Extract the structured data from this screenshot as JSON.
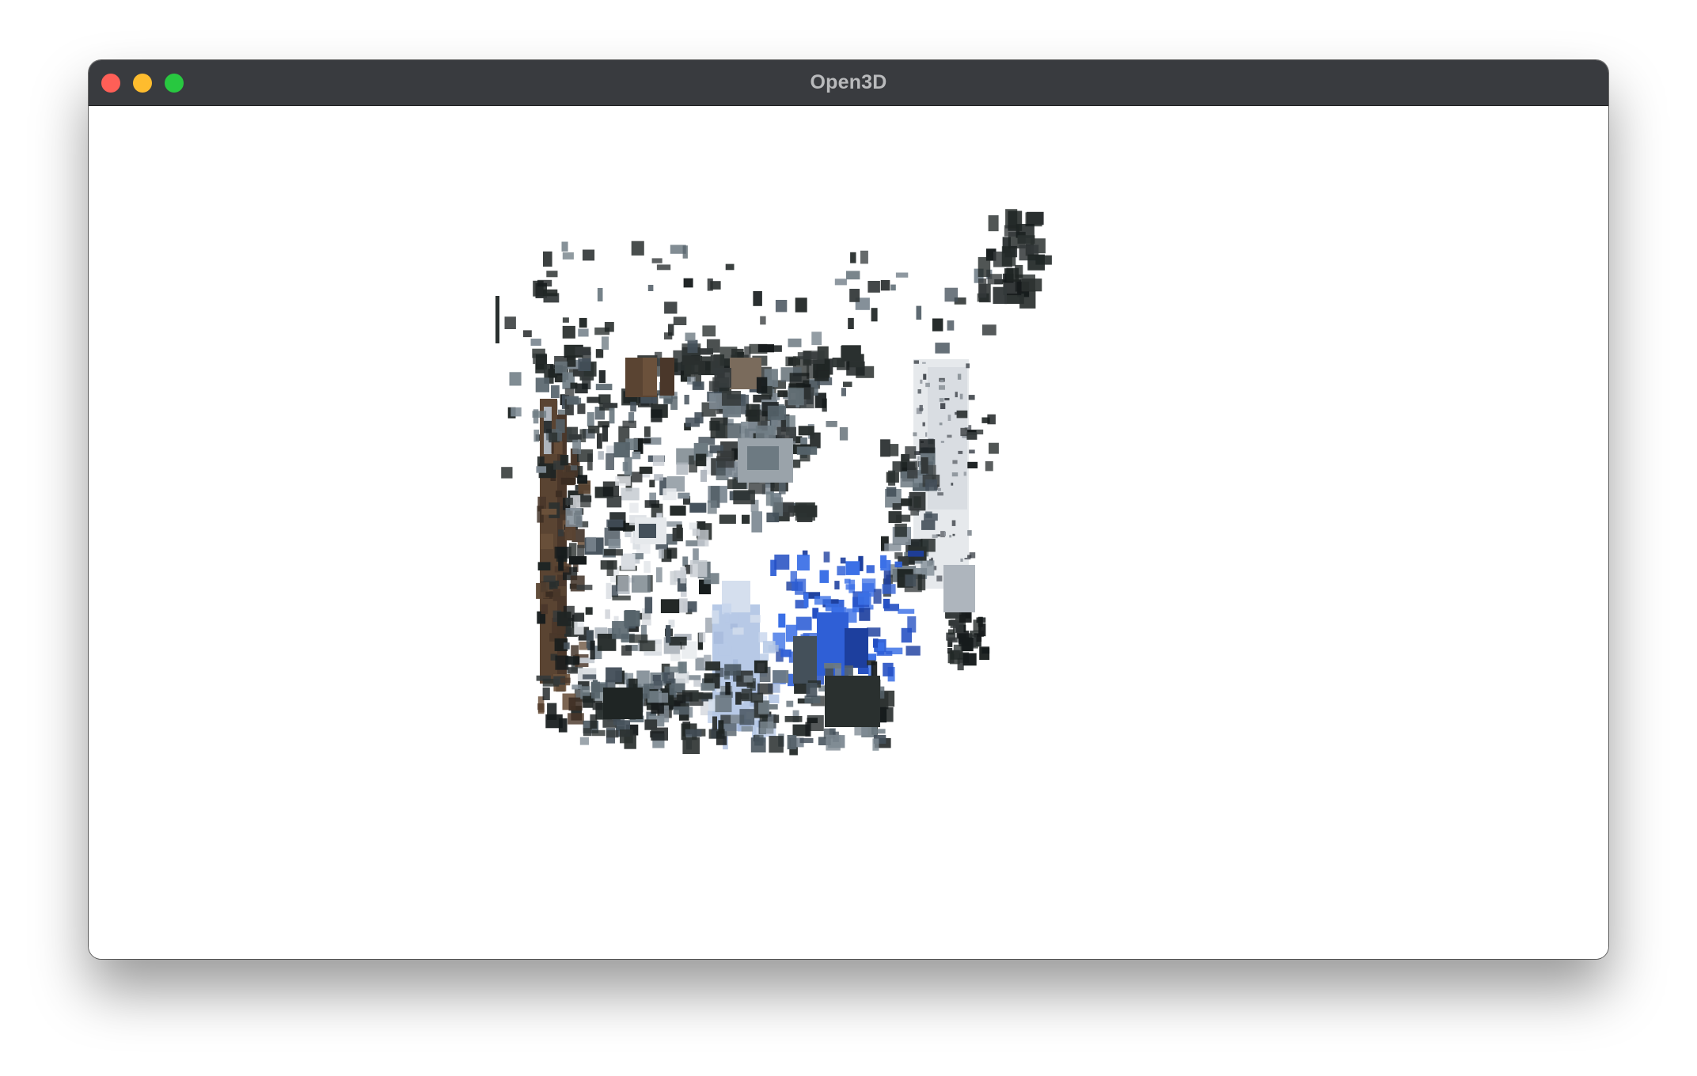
{
  "window": {
    "title": "Open3D",
    "controls": {
      "close_icon": "close-icon",
      "minimize_icon": "minimize-icon",
      "zoom_icon": "zoom-icon",
      "close_color": "#ff5f57",
      "minimize_color": "#febc2e",
      "zoom_color": "#28c840"
    }
  },
  "viewport": {
    "background_color": "#ffffff",
    "content": "point-cloud",
    "palette": {
      "dark": "#1f2524",
      "slate": "#56636b",
      "brown": "#5a4432",
      "paper": "#d9dde2",
      "blue": "#2f5fd6",
      "light_blue": "#b7c9e6"
    }
  }
}
